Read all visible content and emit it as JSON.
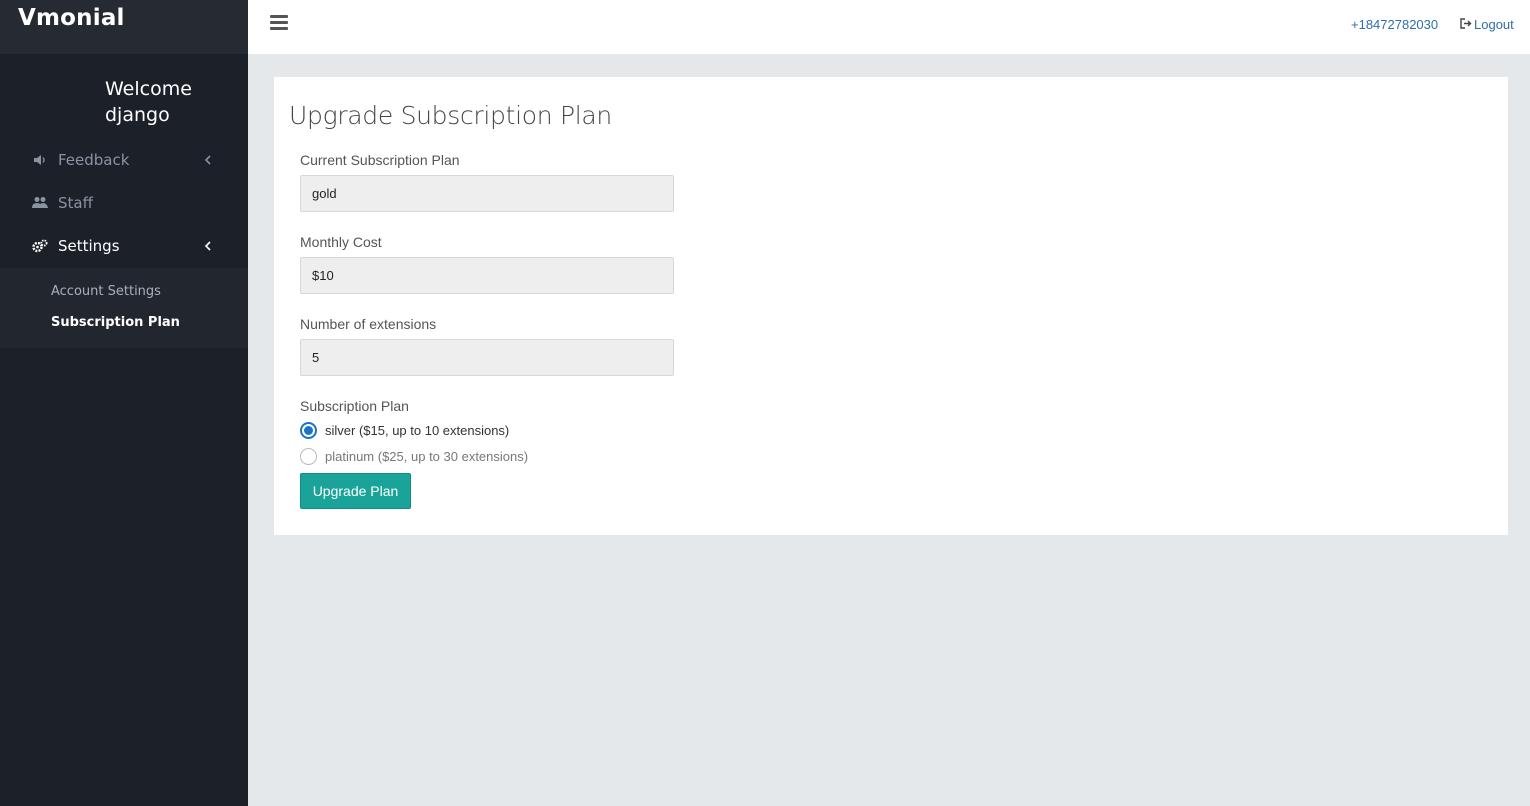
{
  "app": {
    "brand": "Vmonial"
  },
  "welcome": {
    "line1": "Welcome",
    "line2": "django"
  },
  "sidebar": {
    "items": [
      {
        "label": "Feedback",
        "icon": "volume-icon"
      },
      {
        "label": "Staff",
        "icon": "users-icon"
      },
      {
        "label": "Settings",
        "icon": "gears-icon"
      }
    ],
    "submenu": [
      {
        "label": "Account Settings"
      },
      {
        "label": "Subscription Plan",
        "active": true
      }
    ]
  },
  "topbar": {
    "phone": "+18472782030",
    "logout": "Logout"
  },
  "main": {
    "title": "Upgrade Subscription Plan",
    "fields": {
      "current_plan": {
        "label": "Current Subscription Plan",
        "value": "gold"
      },
      "monthly_cost": {
        "label": "Monthly Cost",
        "value": "$10"
      },
      "extensions": {
        "label": "Number of extensions",
        "value": "5"
      }
    },
    "plan": {
      "label": "Subscription Plan",
      "options": [
        {
          "label": "silver ($15, up to 10 extensions)",
          "checked": true
        },
        {
          "label": "platinum ($25, up to 30 extensions)",
          "checked": false
        }
      ]
    },
    "submit_label": "Upgrade Plan"
  },
  "colors": {
    "sidebar_bg": "#1c2029",
    "accent": "#1aa499",
    "link": "#2f6fad",
    "radio": "#1a73c8"
  }
}
